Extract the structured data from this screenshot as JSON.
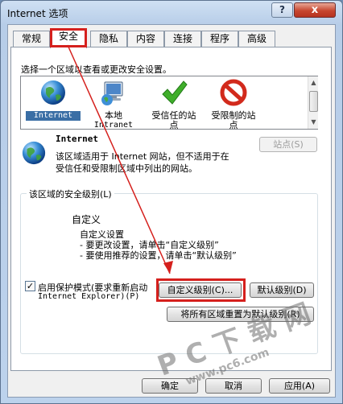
{
  "window": {
    "title": "Internet 选项",
    "help_label": "?",
    "close_label": "x"
  },
  "tabs": [
    {
      "label": "常规"
    },
    {
      "label": "安全"
    },
    {
      "label": "隐私"
    },
    {
      "label": "内容"
    },
    {
      "label": "连接"
    },
    {
      "label": "程序"
    },
    {
      "label": "高级"
    }
  ],
  "zones_prompt": "选择一个区域以查看或更改安全设置。",
  "zones": [
    {
      "label": "Internet",
      "icon": "globe-icon",
      "selected": true
    },
    {
      "label": "本地",
      "label2": "Intranet",
      "icon": "local-intranet-icon"
    },
    {
      "label": "受信任的站",
      "label2": "点",
      "icon": "checkmark-icon"
    },
    {
      "label": "受限制的站",
      "label2": "点",
      "icon": "restricted-icon"
    }
  ],
  "selected_zone": {
    "name": "Internet",
    "desc_line1": "该区域适用于 Internet 网站，但不适用于在",
    "desc_line2": "受信任和受限制区域中列出的网站。"
  },
  "sites_button": "站点(S)",
  "security_level": {
    "group_title": "该区域的安全级别(L)",
    "level_name": "自定义",
    "line1": "自定义设置",
    "line2": "- 要更改设置，请单击“自定义级别”",
    "line3": "- 要使用推荐的设置，请单击“默认级别”"
  },
  "protected_mode": {
    "checked": true,
    "label_line1": "启用保护模式(要求重新启动",
    "label_line2": "Internet Explorer)(P)"
  },
  "buttons": {
    "custom_level": "自定义级别(C)...",
    "default_level": "默认级别(D)",
    "reset_all": "将所有区域重置为默认级别(R)",
    "ok": "确定",
    "cancel": "取消",
    "apply": "应用(A)"
  },
  "watermark": {
    "big": "P C 下 载 网",
    "url": "www.pc6.com"
  }
}
